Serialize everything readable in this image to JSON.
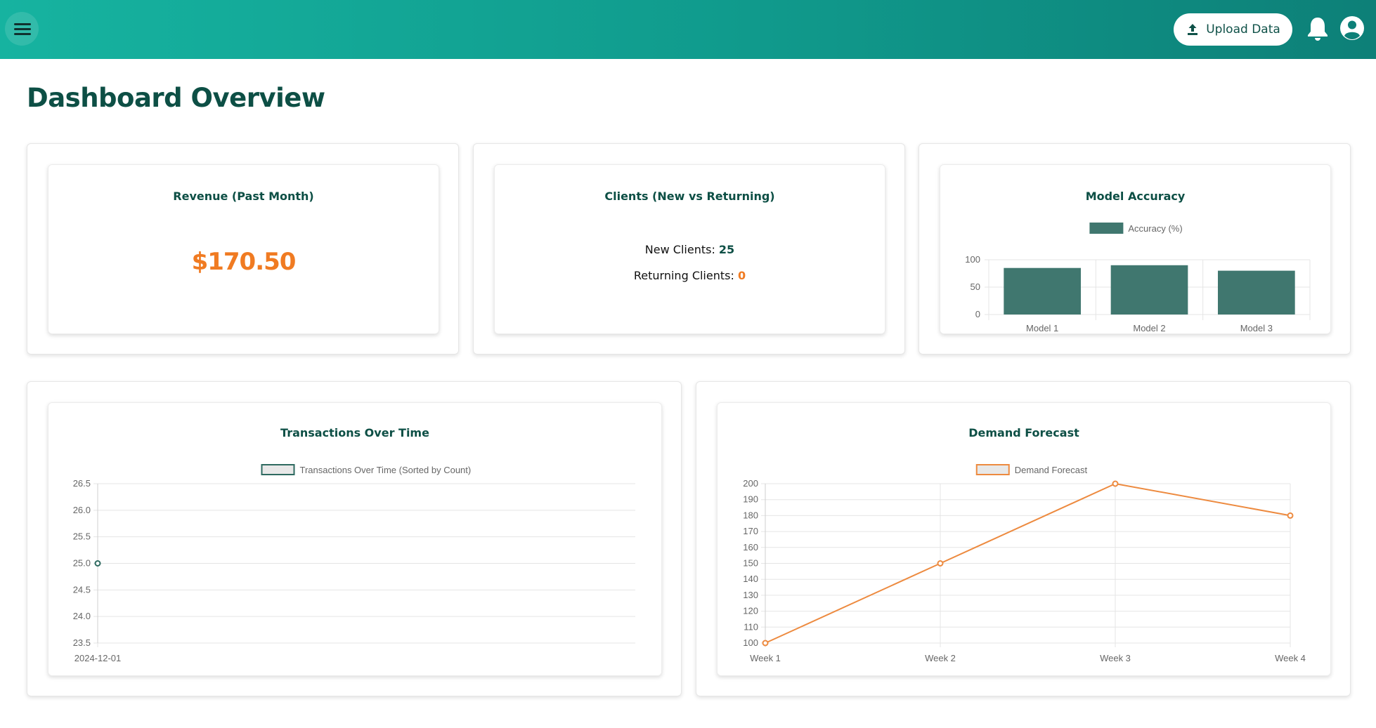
{
  "header": {
    "menu_icon": "hamburger-menu-icon",
    "upload_button": {
      "label": "Upload Data",
      "icon": "upload-icon"
    },
    "notifications_icon": "bell-icon",
    "account_icon": "user-account-icon"
  },
  "page": {
    "title": "Dashboard Overview"
  },
  "cards": {
    "revenue": {
      "title": "Revenue (Past Month)",
      "value": "$170.50",
      "value_color": "#f07b22"
    },
    "clients": {
      "title": "Clients (New vs Returning)",
      "new_label": "New Clients:",
      "new_value": "25",
      "returning_label": "Returning Clients:",
      "returning_value": "0"
    },
    "model_accuracy": {
      "title": "Model Accuracy"
    },
    "transactions": {
      "title": "Transactions Over Time"
    },
    "demand": {
      "title": "Demand Forecast"
    }
  },
  "colors": {
    "brand_dark": "#0d4f45",
    "accent_orange": "#f07b22",
    "bar_fill": "#40776f",
    "header_start": "#16b3a0",
    "header_end": "#0d8078"
  },
  "chart_data": [
    {
      "id": "model-accuracy",
      "type": "bar",
      "title": "",
      "categories": [
        "Model 1",
        "Model 2",
        "Model 3"
      ],
      "series": [
        {
          "name": "Accuracy (%)",
          "values": [
            85,
            90,
            80
          ],
          "color": "#40776f"
        }
      ],
      "ylim": [
        0,
        100
      ],
      "yticks": [
        0,
        50,
        100
      ],
      "legend": "top",
      "grid": true
    },
    {
      "id": "transactions-over-time",
      "type": "line",
      "title": "",
      "x": [
        "2024-12-01"
      ],
      "series": [
        {
          "name": "Transactions Over Time (Sorted by Count)",
          "values": [
            25
          ],
          "color": "#2e6a60"
        }
      ],
      "ylim": [
        23.5,
        26.5
      ],
      "yticks": [
        "23.5",
        "24.0",
        "24.5",
        "25.0",
        "25.5",
        "26.0",
        "26.5"
      ],
      "legend": "top",
      "grid": true
    },
    {
      "id": "demand-forecast",
      "type": "line",
      "title": "",
      "x": [
        "Week 1",
        "Week 2",
        "Week 3",
        "Week 4"
      ],
      "series": [
        {
          "name": "Demand Forecast",
          "values": [
            100,
            150,
            200,
            180
          ],
          "color": "#ed8a3f"
        }
      ],
      "ylim": [
        100,
        200
      ],
      "yticks": [
        "100",
        "110",
        "120",
        "130",
        "140",
        "150",
        "160",
        "170",
        "180",
        "190",
        "200"
      ],
      "legend": "top",
      "grid": true
    }
  ]
}
